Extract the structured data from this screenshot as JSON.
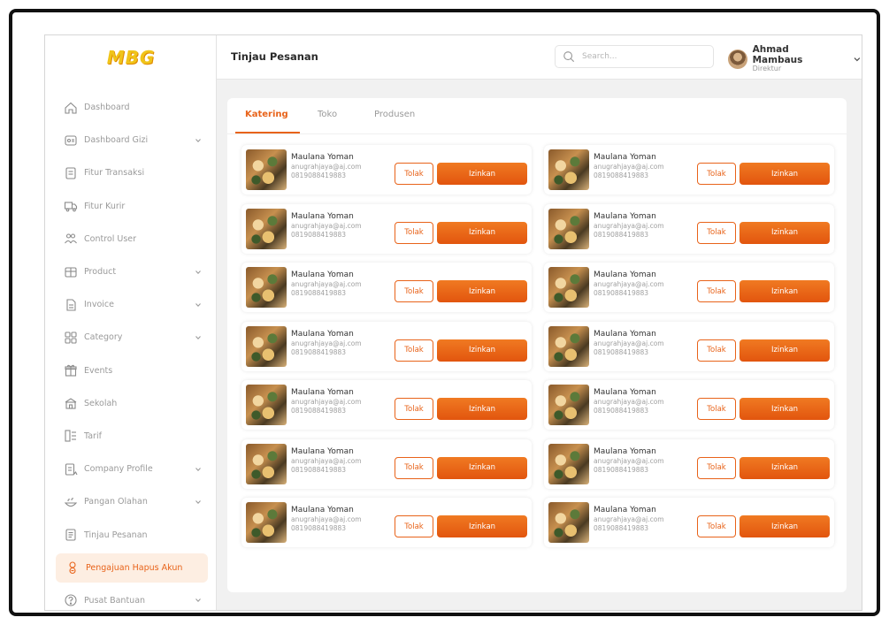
{
  "app": {
    "logo": "MBG",
    "page_title": "Tinjau Pesanan"
  },
  "search": {
    "placeholder": "Search..."
  },
  "user": {
    "name": "Ahmad Mambaus",
    "role": "Direktur"
  },
  "sidebar": {
    "items": [
      {
        "label": "Dashboard",
        "icon": "home-icon",
        "has_chevron": false
      },
      {
        "label": "Dashboard Gizi",
        "icon": "nutrition-icon",
        "has_chevron": true
      },
      {
        "label": "Fitur Transaksi",
        "icon": "receipt-icon",
        "has_chevron": false
      },
      {
        "label": "Fitur Kurir",
        "icon": "truck-icon",
        "has_chevron": false
      },
      {
        "label": "Control User",
        "icon": "users-icon",
        "has_chevron": false
      },
      {
        "label": "Product",
        "icon": "box-icon",
        "has_chevron": true
      },
      {
        "label": "Invoice",
        "icon": "invoice-icon",
        "has_chevron": true
      },
      {
        "label": "Category",
        "icon": "category-icon",
        "has_chevron": true
      },
      {
        "label": "Events",
        "icon": "gift-icon",
        "has_chevron": false
      },
      {
        "label": "Sekolah",
        "icon": "school-icon",
        "has_chevron": false
      },
      {
        "label": "Tarif",
        "icon": "tariff-icon",
        "has_chevron": false
      },
      {
        "label": "Company Profile",
        "icon": "company-icon",
        "has_chevron": true
      },
      {
        "label": "Pangan Olahan",
        "icon": "food-icon",
        "has_chevron": true
      },
      {
        "label": "Tinjau Pesanan",
        "icon": "review-icon",
        "has_chevron": false
      },
      {
        "label": "Pengajuan Hapus Akun",
        "icon": "user-delete-icon",
        "has_chevron": false,
        "active": true
      },
      {
        "label": "Pusat Bantuan",
        "icon": "help-icon",
        "has_chevron": true
      }
    ]
  },
  "tabs": [
    {
      "label": "Katering",
      "active": true
    },
    {
      "label": "Toko",
      "active": false
    },
    {
      "label": "Produsen",
      "active": false
    }
  ],
  "buttons": {
    "reject": "Tolak",
    "approve": "Izinkan"
  },
  "orders": [
    {
      "name": "Maulana Yoman",
      "email": "anugrahjaya@aj.com",
      "phone": "0819088419883"
    },
    {
      "name": "Maulana Yoman",
      "email": "anugrahjaya@aj.com",
      "phone": "0819088419883"
    },
    {
      "name": "Maulana Yoman",
      "email": "anugrahjaya@aj.com",
      "phone": "0819088419883"
    },
    {
      "name": "Maulana Yoman",
      "email": "anugrahjaya@aj.com",
      "phone": "0819088419883"
    },
    {
      "name": "Maulana Yoman",
      "email": "anugrahjaya@aj.com",
      "phone": "0819088419883"
    },
    {
      "name": "Maulana Yoman",
      "email": "anugrahjaya@aj.com",
      "phone": "0819088419883"
    },
    {
      "name": "Maulana Yoman",
      "email": "anugrahjaya@aj.com",
      "phone": "0819088419883"
    },
    {
      "name": "Maulana Yoman",
      "email": "anugrahjaya@aj.com",
      "phone": "0819088419883"
    },
    {
      "name": "Maulana Yoman",
      "email": "anugrahjaya@aj.com",
      "phone": "0819088419883"
    },
    {
      "name": "Maulana Yoman",
      "email": "anugrahjaya@aj.com",
      "phone": "0819088419883"
    },
    {
      "name": "Maulana Yoman",
      "email": "anugrahjaya@aj.com",
      "phone": "0819088419883"
    },
    {
      "name": "Maulana Yoman",
      "email": "anugrahjaya@aj.com",
      "phone": "0819088419883"
    },
    {
      "name": "Maulana Yoman",
      "email": "anugrahjaya@aj.com",
      "phone": "0819088419883"
    },
    {
      "name": "Maulana Yoman",
      "email": "anugrahjaya@aj.com",
      "phone": "0819088419883"
    }
  ],
  "colors": {
    "accent": "#e8631a",
    "logo": "#f0c419",
    "active_bg": "#fdeee2"
  }
}
